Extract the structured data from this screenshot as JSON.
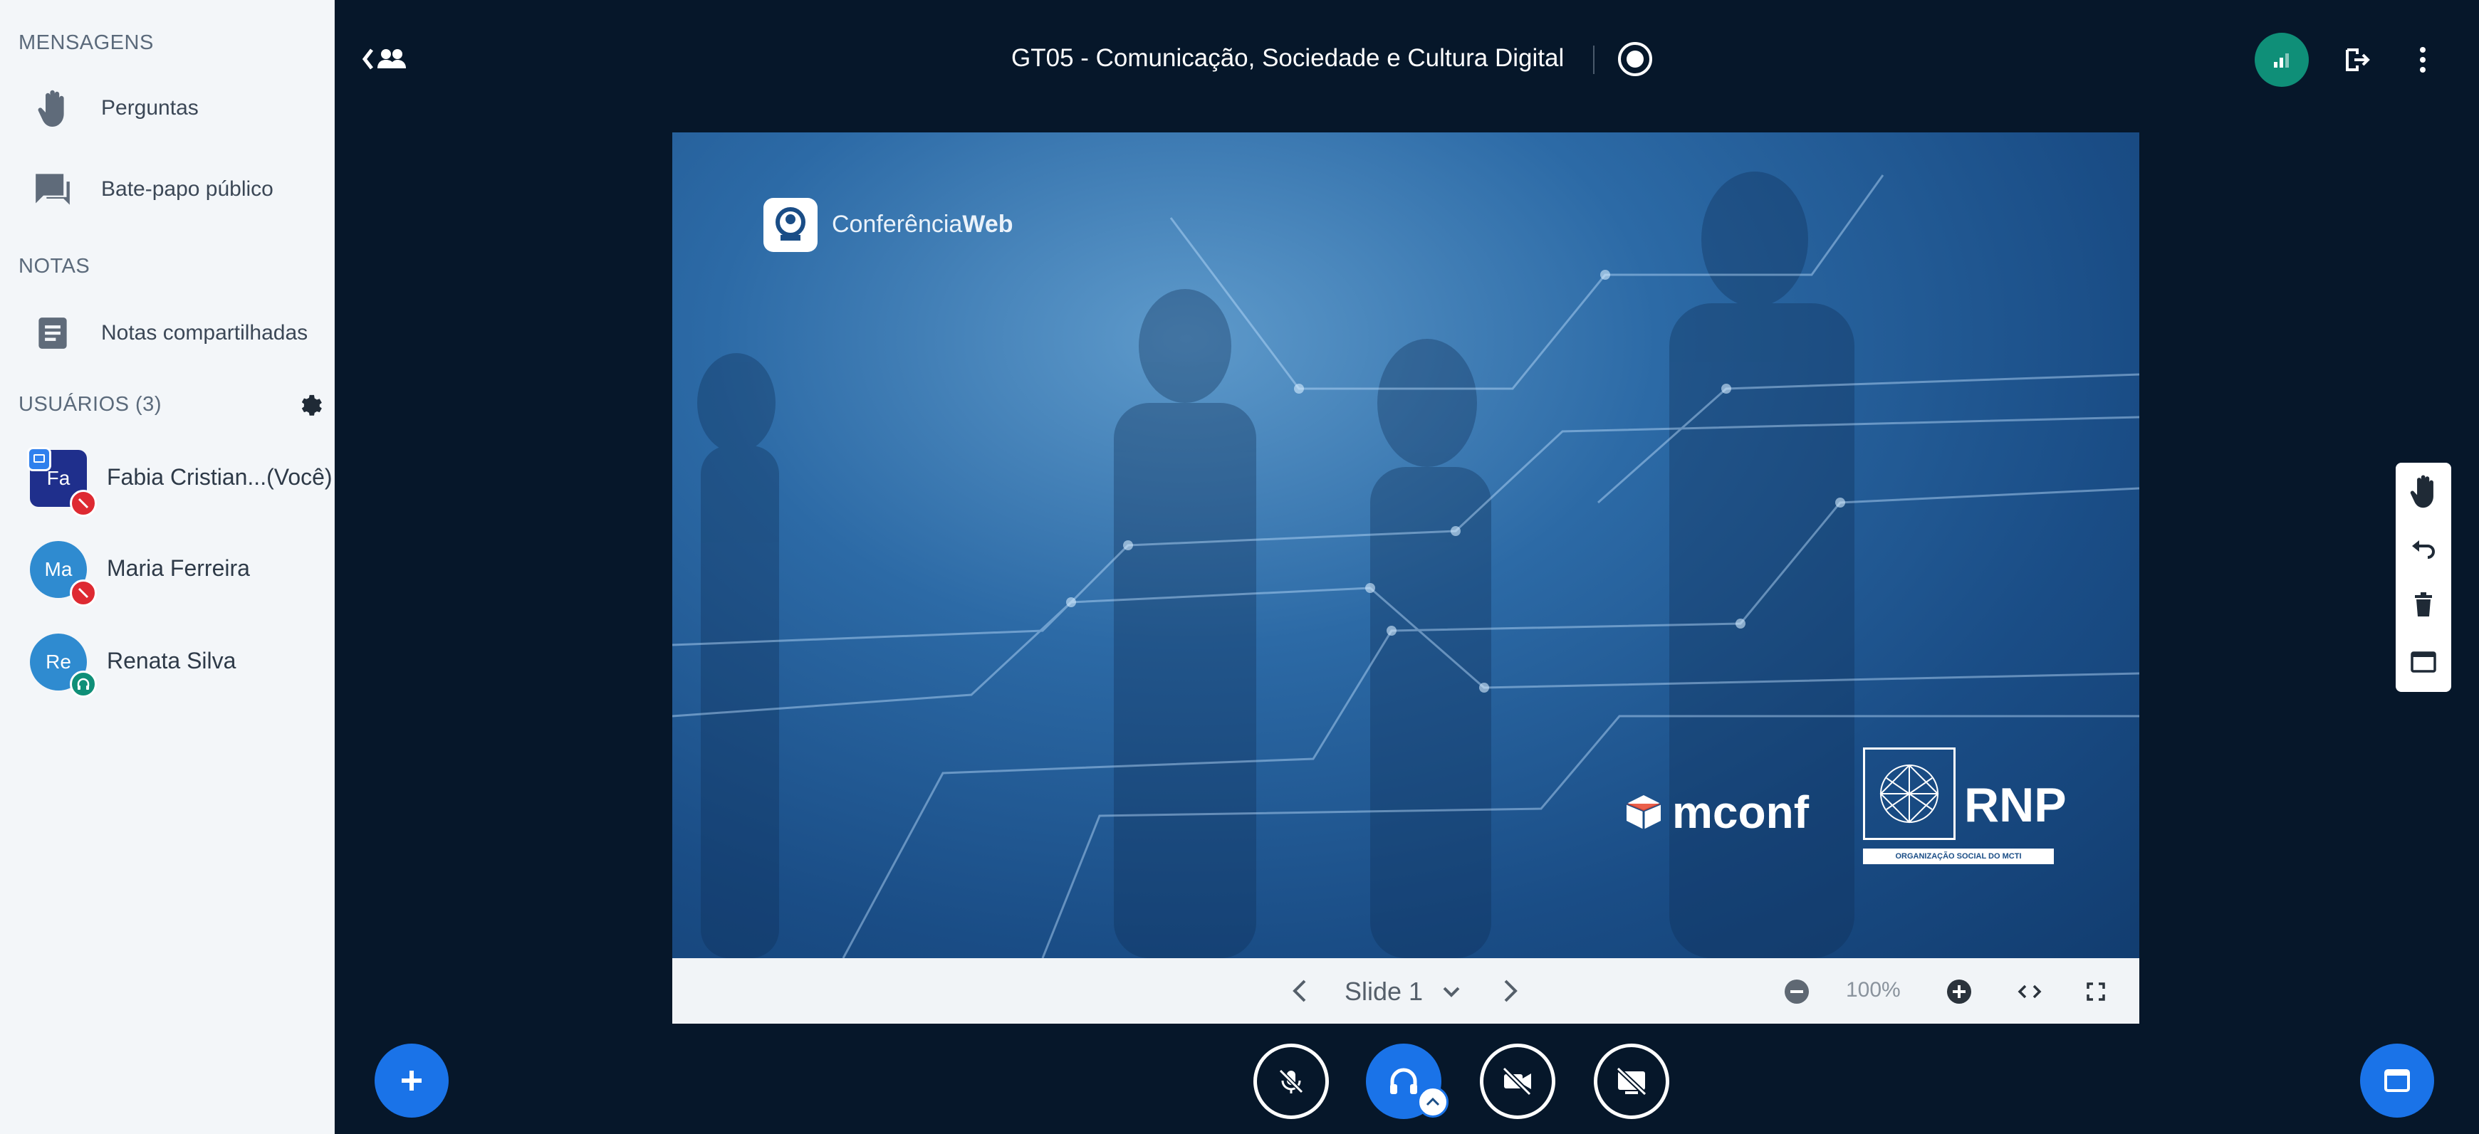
{
  "sidebar": {
    "messages_title": "MENSAGENS",
    "items_messages": [
      {
        "label": "Perguntas",
        "icon": "hand-icon"
      },
      {
        "label": "Bate-papo público",
        "icon": "chat-icon"
      }
    ],
    "notes_title": "NOTAS",
    "items_notes": [
      {
        "label": "Notas compartilhadas",
        "icon": "notes-icon"
      }
    ],
    "users_title": "USUÁRIOS (3)",
    "users": [
      {
        "initials": "Fa",
        "name": "Fabia Cristian...(Você)",
        "status": "muted",
        "presenter": true
      },
      {
        "initials": "Ma",
        "name": "Maria Ferreira",
        "status": "muted"
      },
      {
        "initials": "Re",
        "name": "Renata Silva",
        "status": "listen-only"
      }
    ]
  },
  "header": {
    "title": "GT05 - Comunicação, Sociedade e Cultura Digital"
  },
  "slide": {
    "brand": "Conferência",
    "brand_bold": "Web",
    "mconf": "mconf",
    "rnp": "RNP",
    "rnp_sub": "ORGANIZAÇÃO SOCIAL DO MCTI"
  },
  "slide_controls": {
    "slide_label": "Slide 1",
    "zoom": "100%"
  },
  "colors": {
    "background": "#06172A",
    "sidebar": "#F3F6F9",
    "accent": "#1A73E8",
    "connection": "#0F8F78",
    "muted_badge": "#DE2A32"
  }
}
